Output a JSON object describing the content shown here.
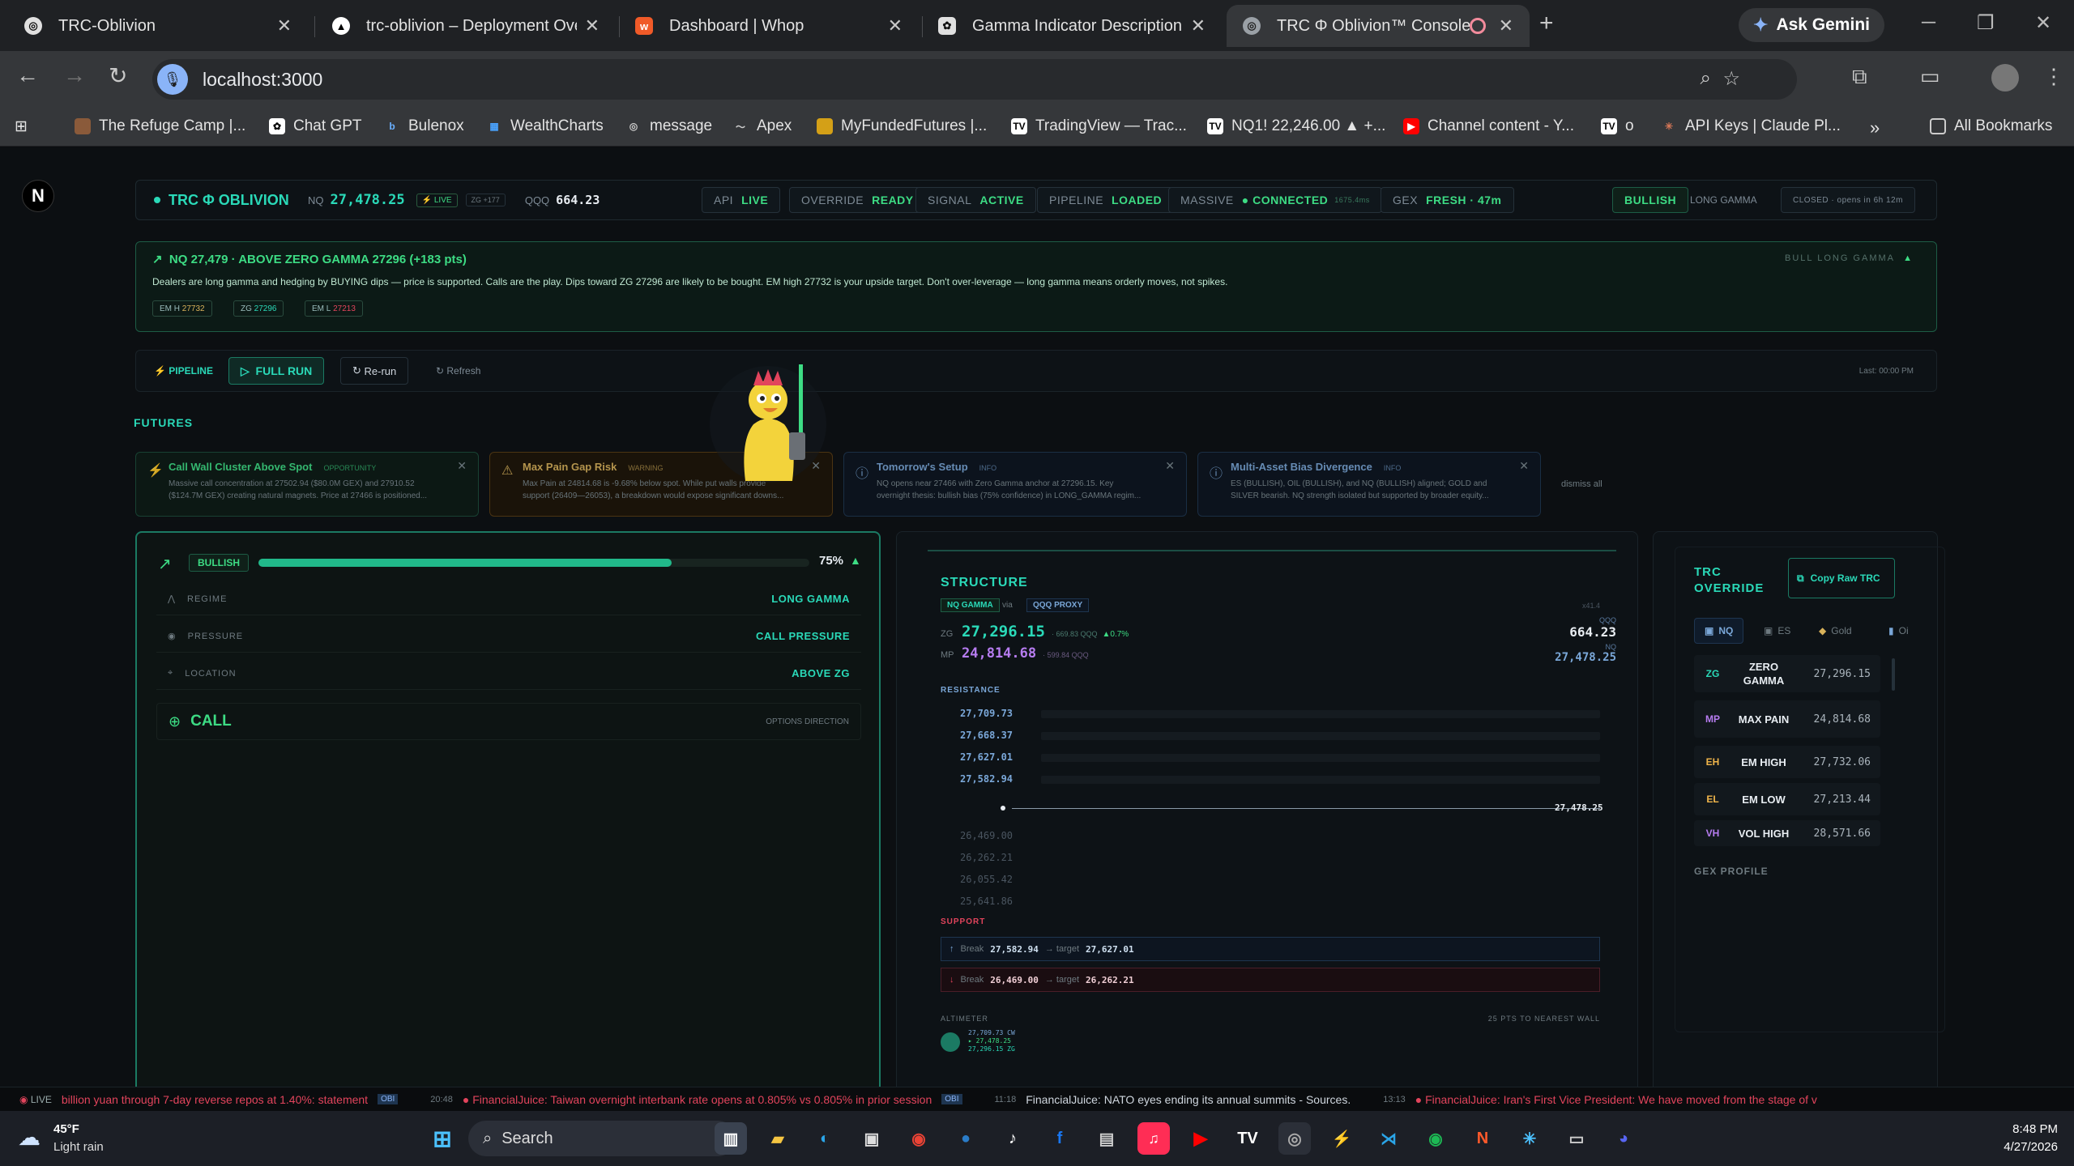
{
  "browser": {
    "tabs": [
      {
        "title": "TRC-Oblivion"
      },
      {
        "title": "trc-oblivion – Deployment Over"
      },
      {
        "title": "Dashboard | Whop"
      },
      {
        "title": "Gamma Indicator Description"
      },
      {
        "title": "TRC Φ Oblivion™ Console"
      }
    ],
    "ask_gemini": "Ask Gemini",
    "url": "localhost:3000",
    "bookmarks": [
      "The Refuge Camp |...",
      "Chat GPT",
      "Bulenox",
      "WealthCharts",
      "message",
      "Apex",
      "MyFundedFutures |...",
      "TradingView — Trac...",
      "NQ1! 22,246.00 ▲ +...",
      "Channel content - Y...",
      "o",
      "API Keys | Claude Pl..."
    ],
    "all_bookmarks": "All Bookmarks"
  },
  "header": {
    "logo": "N",
    "brand": "TRC Φ OBLIVION",
    "nq_label": "NQ",
    "nq_value": "27,478.25",
    "live": "LIVE",
    "zg_delta": "ZG +177",
    "qqq_label": "QQQ",
    "qqq_value": "664.23",
    "pills": [
      {
        "k": "API",
        "v": "LIVE"
      },
      {
        "k": "OVERRIDE",
        "v": "READY"
      },
      {
        "k": "SIGNAL",
        "v": "ACTIVE"
      },
      {
        "k": "PIPELINE",
        "v": "LOADED"
      },
      {
        "k": "MASSIVE",
        "v": "CONNECTED",
        "extra": "1675.4ms"
      },
      {
        "k": "GEX",
        "v": "FRESH · 47m"
      }
    ],
    "bias": "BULLISH",
    "gamma": "LONG GAMMA",
    "market": "CLOSED · opens in 6h 12m"
  },
  "alert": {
    "headline": "NQ 27,479 · ABOVE ZERO GAMMA 27296 (+183 pts)",
    "body": "Dealers are long gamma and hedging by BUYING dips — price is supported. Calls are the play. Dips toward ZG 27296 are likely to be bought. EM high 27732 is your upside target. Don't over-leverage — long gamma means orderly moves, not spikes.",
    "chips": [
      {
        "k": "EM H",
        "v": "27732"
      },
      {
        "k": "ZG",
        "v": "27296"
      },
      {
        "k": "EM L",
        "v": "27213"
      }
    ],
    "tag": "BULL LONG GAMMA"
  },
  "pipeline": {
    "label": "PIPELINE",
    "full_run": "FULL RUN",
    "rerun": "Re-run",
    "refresh": "Refresh",
    "last": "Last: 00:00 PM"
  },
  "futures_label": "FUTURES",
  "cards": [
    {
      "title": "Call Wall Cluster Above Spot",
      "tag": "OPPORTUNITY",
      "body1": "Massive call concentration at 27502.94 ($80.0M GEX) and 27910.52",
      "body2": "($124.7M GEX) creating natural magnets. Price at 27466 is positioned..."
    },
    {
      "title": "Max Pain Gap Risk",
      "tag": "WARNING",
      "body1": "Max Pain at 24814.68 is -9.68% below spot. While put walls provide",
      "body2": "support (26409—26053), a breakdown would expose significant downs..."
    },
    {
      "title": "Tomorrow's Setup",
      "tag": "INFO",
      "body1": "NQ opens near 27466 with Zero Gamma anchor at 27296.15. Key",
      "body2": "overnight thesis: bullish bias (75% confidence) in LONG_GAMMA regim..."
    },
    {
      "title": "Multi-Asset Bias Divergence",
      "tag": "INFO",
      "body1": "ES (BULLISH), OIL (BULLISH), and NQ (BULLISH) aligned; GOLD and",
      "body2": "SILVER bearish. NQ strength isolated but supported by broader equity..."
    }
  ],
  "dismiss_all": "dismiss all",
  "left": {
    "bias": "BULLISH",
    "confidence": 0.75,
    "confidence_text": "75%",
    "rows": [
      {
        "k": "REGIME",
        "v": "LONG GAMMA"
      },
      {
        "k": "PRESSURE",
        "v": "CALL PRESSURE"
      },
      {
        "k": "LOCATION",
        "v": "ABOVE ZG"
      }
    ],
    "call": "CALL",
    "call_sub": "OPTIONS DIRECTION"
  },
  "structure": {
    "title": "STRUCTURE",
    "tab_nq": "NQ GAMMA",
    "via": "via",
    "tab_qqq": "QQQ PROXY",
    "mult": "x41.4",
    "zg_label": "ZG",
    "zg_value": "27,296.15",
    "zg_sub": "· 669.83 QQQ",
    "zg_pct": "▲0.7%",
    "mp_label": "MP",
    "mp_value": "24,814.68",
    "mp_sub": "· 599.84 QQQ",
    "qqq_label": "QQQ",
    "qqq_value": "664.23",
    "nq_label": "NQ",
    "nq_value": "27,478.25",
    "resistance_label": "RESISTANCE",
    "resistance": [
      "27,709.73",
      "27,668.37",
      "27,627.01",
      "27,582.94"
    ],
    "spot": "27,478.25",
    "support_levels": [
      "26,469.00",
      "26,262.21",
      "26,055.42",
      "25,641.86"
    ],
    "support_label": "SUPPORT",
    "break_up": {
      "k": "Break",
      "v": "27,582.94",
      "arrow": "→ target",
      "t": "27,627.01"
    },
    "break_dn": {
      "k": "Break",
      "v": "26,469.00",
      "arrow": "→ target",
      "t": "26,262.21"
    },
    "altimeter": "ALTIMETER",
    "nearest": "25 PTS TO NEAREST WALL",
    "alt_vals": [
      "27,709.73 CW",
      "▸ 27,478.25",
      "27,296.15 ZG"
    ]
  },
  "override": {
    "title": "TRC OVERRIDE",
    "copy": "Copy Raw TRC",
    "assets": [
      "NQ",
      "ES",
      "Gold",
      "Oi"
    ],
    "rows": [
      {
        "k": "ZG",
        "n": "ZERO GAMMA",
        "v": "27,296.15",
        "c": "#2ad9b8"
      },
      {
        "k": "MP",
        "n": "MAX PAIN",
        "v": "24,814.68",
        "c": "#b67cf0"
      },
      {
        "k": "EH",
        "n": "EM HIGH",
        "v": "27,732.06",
        "c": "#f0b54a"
      },
      {
        "k": "EL",
        "n": "EM LOW",
        "v": "27,213.44",
        "c": "#f0b54a"
      },
      {
        "k": "VH",
        "n": "VOL HIGH",
        "v": "28,571.66",
        "c": "#b67cf0"
      }
    ],
    "gex": "GEX PROFILE"
  },
  "ticker": {
    "live": "LIVE",
    "items": [
      {
        "time": "",
        "text": "billion yuan through 7-day reverse repos at 1.40%: statement",
        "tag": "OBI"
      },
      {
        "time": "20:48",
        "text": "FinancialJuice: Taiwan overnight interbank rate opens at 0.805% vs 0.805% in prior session",
        "tag": "OBI"
      },
      {
        "time": "11:18",
        "text": "FinancialJuice: NATO eyes ending its annual summits - Sources.",
        "tag": ""
      },
      {
        "time": "13:13",
        "text": "FinancialJuice: Iran's First Vice President: We have moved from the stage of v",
        "tag": ""
      }
    ]
  },
  "taskbar": {
    "weather_temp": "45°F",
    "weather_desc": "Light rain",
    "search": "Search",
    "time": "8:48 PM",
    "date": "4/27/2026"
  }
}
